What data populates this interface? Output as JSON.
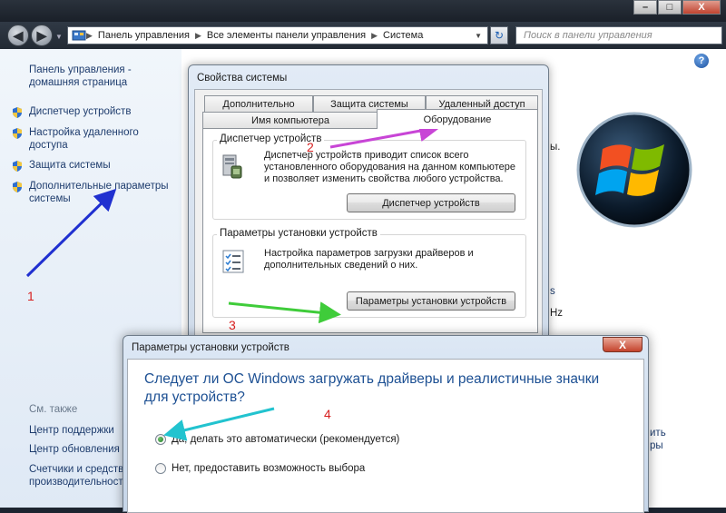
{
  "window": {
    "minimize": "–",
    "maximize": "□",
    "close": "X"
  },
  "toolbar": {
    "breadcrumb": [
      "Панель управления",
      "Все элементы панели управления",
      "Система"
    ],
    "search_placeholder": "Поиск в панели управления"
  },
  "sidebar": {
    "home": "Панель управления - домашняя страница",
    "items": [
      {
        "label": "Диспетчер устройств",
        "icon": "shield-icon"
      },
      {
        "label": "Настройка удаленного доступа",
        "icon": "shield-icon"
      },
      {
        "label": "Защита системы",
        "icon": "shield-icon"
      },
      {
        "label": "Дополнительные параметры системы",
        "icon": "shield-icon"
      }
    ],
    "see_also": "См. также",
    "see_also_items": [
      "Центр поддержки",
      "Центр обновления",
      "Счетчики и средств производительности"
    ]
  },
  "main_fragments": {
    "frag1": "ы.",
    "frag2": "s",
    "frag3": "Hz",
    "frag4": "ить",
    "frag5": "ры"
  },
  "system_properties": {
    "title": "Свойства системы",
    "tabs": [
      "Дополнительно",
      "Защита системы",
      "Удаленный доступ",
      "Имя компьютера",
      "Оборудование"
    ],
    "device_manager": {
      "group_label": "Диспетчер устройств",
      "description": "Диспетчер устройств приводит список всего установленного оборудования на данном компьютере и позволяет изменить свойства любого устройства.",
      "button": "Диспетчер устройств"
    },
    "device_install": {
      "group_label": "Параметры установки устройств",
      "description": "Настройка параметров загрузки драйверов и дополнительных сведений о них.",
      "button": "Параметры установки устройств"
    }
  },
  "device_settings_dialog": {
    "title": "Параметры установки устройств",
    "close": "X",
    "question": "Следует ли ОС Windows загружать драйверы и реалистичные значки для устройств?",
    "options": [
      {
        "label": "Да, делать это автоматически (рекомендуется)",
        "selected": true
      },
      {
        "label": "Нет, предоставить возможность выбора",
        "selected": false
      }
    ]
  },
  "annotations": {
    "n1": "1",
    "n2": "2",
    "n3": "3",
    "n4": "4"
  },
  "colors": {
    "arrow1": "#2030d0",
    "arrow2": "#c845d6",
    "arrow3": "#3fcc3a",
    "arrow4": "#22c3cf",
    "number": "#d71f1f"
  }
}
